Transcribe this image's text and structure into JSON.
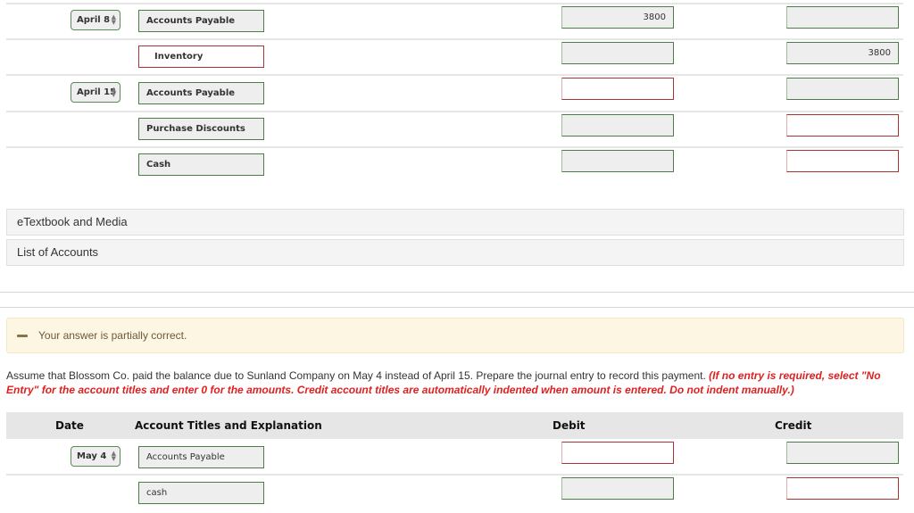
{
  "top_entries": [
    {
      "date": "April 8",
      "account": "Accounts Payable",
      "account_state": "correct",
      "debit": "3800",
      "debit_state": "correct",
      "credit": "",
      "credit_state": "correct"
    },
    {
      "date": null,
      "account": "Inventory",
      "account_state": "incorrect",
      "debit": "",
      "debit_state": "correct",
      "credit": "3800",
      "credit_state": "correct"
    },
    {
      "date": "April 15",
      "account": "Accounts Payable",
      "account_state": "correct",
      "debit": "",
      "debit_state": "incorrect",
      "credit": "",
      "credit_state": "correct"
    },
    {
      "date": null,
      "account": "Purchase Discounts",
      "account_state": "correct",
      "debit": "",
      "debit_state": "correct",
      "credit": "",
      "credit_state": "incorrect"
    },
    {
      "date": null,
      "account": "Cash",
      "account_state": "correct",
      "debit": "",
      "debit_state": "correct",
      "credit": "",
      "credit_state": "incorrect"
    }
  ],
  "panels": {
    "etextbook": "eTextbook and Media",
    "list_of_accounts": "List of Accounts"
  },
  "notice": {
    "text": "Your answer is partially correct.",
    "icon": "minus-icon"
  },
  "question": {
    "text": "Assume that Blossom Co. paid the balance due to Sunland Company on May 4 instead of April 15. Prepare the journal entry to record this payment. ",
    "hint": "(If no entry is required, select \"No Entry\" for the account titles and enter 0 for the amounts. Credit account titles are automatically indented when amount is entered. Do not indent manually.)"
  },
  "table": {
    "headers": {
      "date": "Date",
      "account": "Account Titles and Explanation",
      "debit": "Debit",
      "credit": "Credit"
    },
    "rows": [
      {
        "date": "May 4",
        "account": "Accounts Payable",
        "account_state": "correct",
        "debit": "",
        "debit_state": "incorrect",
        "credit": "",
        "credit_state": "correct"
      },
      {
        "date": null,
        "account": "cash",
        "account_state": "correct",
        "debit": "",
        "debit_state": "correct",
        "credit": "",
        "credit_state": "incorrect"
      }
    ]
  },
  "colors": {
    "correct_border": "#4f7d4a",
    "incorrect_border": "#aa3333",
    "hint_text": "#e02020",
    "notice_bg": "#fdf6e3"
  }
}
